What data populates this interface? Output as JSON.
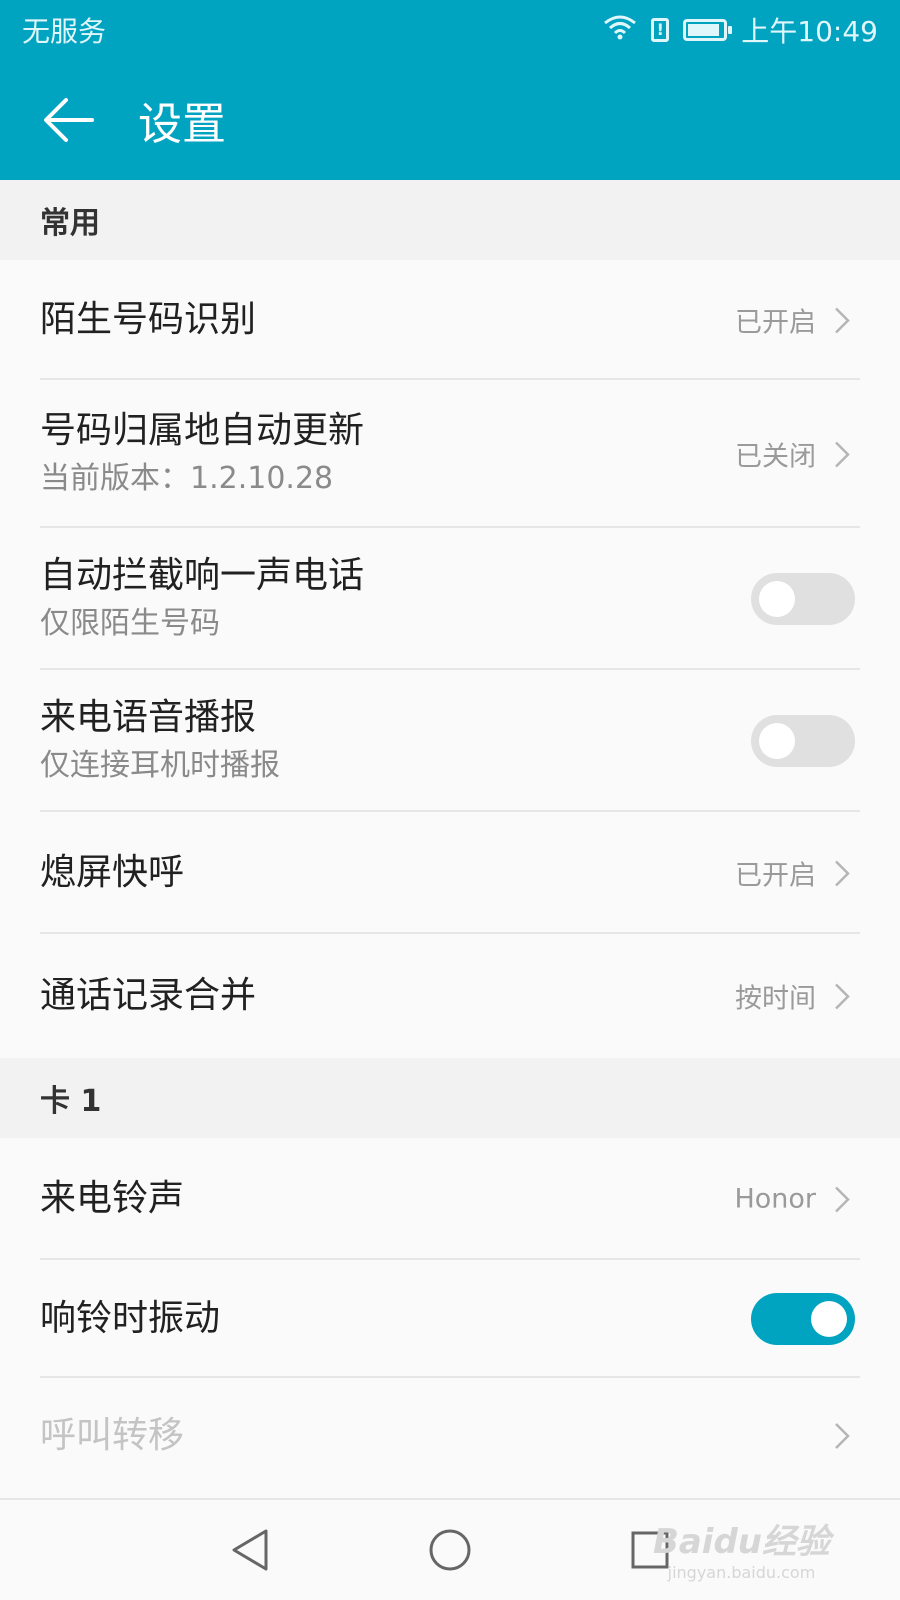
{
  "status_bar": {
    "carrier": "无服务",
    "time": "上午10:49",
    "alert_glyph": "!"
  },
  "app_bar": {
    "title": "设置",
    "back_icon": "arrow-left-icon"
  },
  "sections": [
    {
      "header": "常用",
      "items": [
        {
          "title": "陌生号码识别",
          "value": "已开启"
        },
        {
          "title": "号码归属地自动更新",
          "subtitle": "当前版本：1.2.10.28",
          "value": "已关闭"
        },
        {
          "title": "自动拦截响一声电话",
          "subtitle": "仅限陌生号码",
          "toggle": false
        },
        {
          "title": "来电语音播报",
          "subtitle": "仅连接耳机时播报",
          "toggle": false
        },
        {
          "title": "熄屏快呼",
          "value": "已开启"
        },
        {
          "title": "通话记录合并",
          "value": "按时间"
        }
      ]
    },
    {
      "header": "卡 1",
      "items": [
        {
          "title": "来电铃声",
          "value": "Honor"
        },
        {
          "title": "响铃时振动",
          "toggle": true
        },
        {
          "title": "呼叫转移",
          "disabled": true
        }
      ]
    }
  ],
  "watermark": {
    "line1": "Baidu经验",
    "line2": "jingyan.baidu.com"
  },
  "colors": {
    "accent": "#00a3c0",
    "background": "#fafafa",
    "section_bg": "#f2f2f2"
  },
  "icons": [
    "wifi-icon",
    "sim-alert-icon",
    "battery-icon",
    "arrow-left-icon",
    "chevron-right-icon",
    "nav-back-icon",
    "nav-home-icon",
    "nav-recents-icon"
  ]
}
